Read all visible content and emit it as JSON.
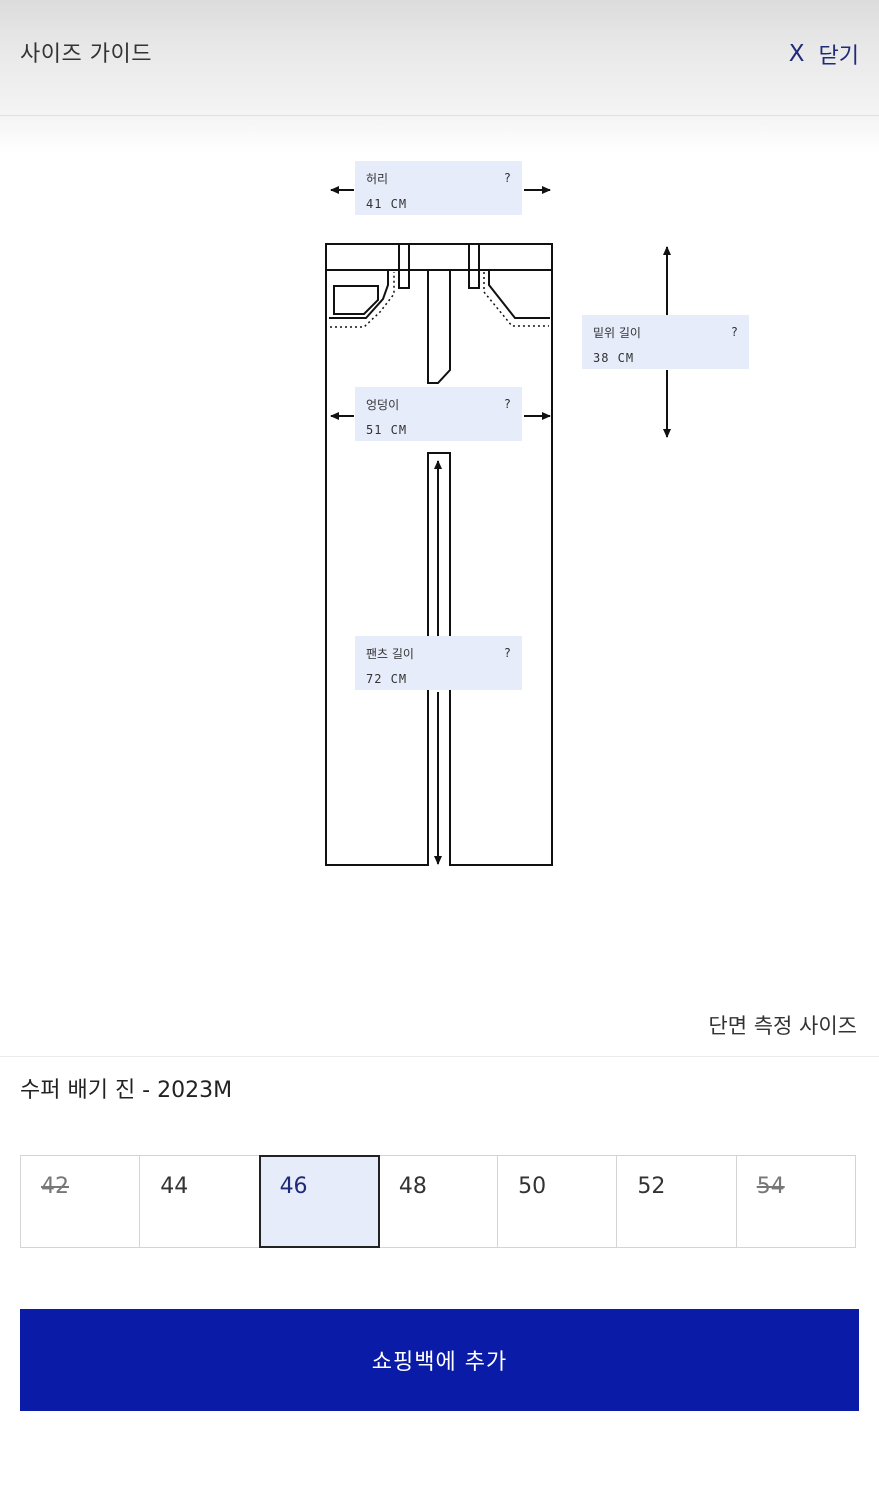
{
  "header": {
    "title": "사이즈 가이드",
    "close_icon": "X",
    "close_label": "닫기"
  },
  "diagram": {
    "labels": [
      {
        "name": "허리",
        "value": "41 CM",
        "help": "?"
      },
      {
        "name": "밑위 길이",
        "value": "38 CM",
        "help": "?"
      },
      {
        "name": "엉덩이",
        "value": "51 CM",
        "help": "?"
      },
      {
        "name": "팬츠 길이",
        "value": "72 CM",
        "help": "?"
      }
    ],
    "note": "단면 측정 사이즈"
  },
  "product": {
    "name": "수퍼 배기 진 - 2023M"
  },
  "sizes": [
    {
      "label": "42",
      "available": false
    },
    {
      "label": "44",
      "available": true
    },
    {
      "label": "46",
      "available": true,
      "selected": true
    },
    {
      "label": "48",
      "available": true
    },
    {
      "label": "50",
      "available": true
    },
    {
      "label": "52",
      "available": true
    },
    {
      "label": "54",
      "available": false
    }
  ],
  "cta": {
    "label": "쇼핑백에 추가"
  },
  "colors": {
    "accent": "#0a1ba8",
    "label_bg": "#e6ecfa",
    "close_text": "#1f2a78"
  }
}
